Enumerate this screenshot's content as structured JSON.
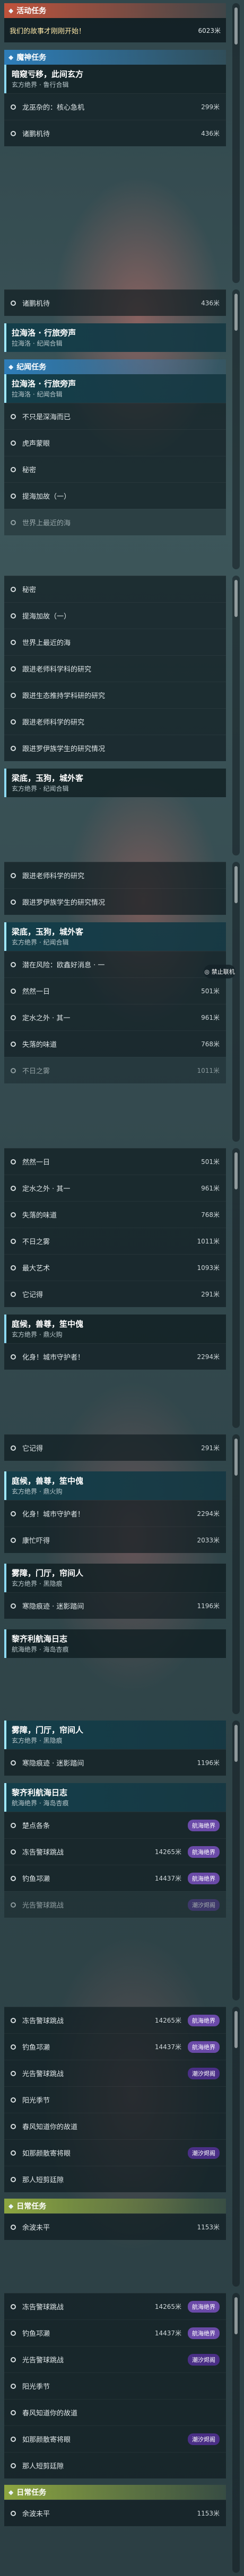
{
  "activity": {
    "category_label": "活动任务",
    "event_title": "我们的故事才刚刚开始！",
    "event_distance": "6023米"
  },
  "main_quest": {
    "category_label": "魔神任务",
    "header_title": "暗窥亏移，此间玄方",
    "header_subtitle": "玄方绝界 · 鲁行合辑",
    "items": [
      {
        "label": "龙巫杂的：核心急机",
        "distance": "299米"
      },
      {
        "label": "诸鹏机待",
        "distance": "436米"
      }
    ],
    "last_item": {
      "label": "诸鹏机待",
      "distance": "436米"
    }
  },
  "quest_groups": [
    {
      "title": "拉海洛 · 行旅旁声",
      "subtitle": "拉海洛 · 纪闻合辑"
    },
    {
      "title": "梁底，玉狗，城外客",
      "subtitle": "玄方绝界 · 纪闻合辑"
    },
    {
      "title": "梁底，玉狗，城外客",
      "subtitle": "玄方绝界 · 纪闻合辑"
    },
    {
      "title": "庭候，兽尊，笙中傀",
      "subtitle": "玄方绝界 · 鼎火购"
    },
    {
      "title": "庭候，兽尊，笙中傀",
      "subtitle": "玄方绝界 · 鼎火购"
    },
    {
      "title": "雾障，门厅，帘间人",
      "subtitle": "玄方绝界 · 黑隐痕"
    },
    {
      "title": "黎齐利航海日志",
      "subtitle": "航海绝界 · 海岛杏痕"
    },
    {
      "title": "雾障，门厅，帘间人",
      "subtitle": "玄方绝界 · 黑隐痕"
    },
    {
      "title": "黎齐利航海日志",
      "subtitle": "航海绝界 · 海岛杏痕"
    }
  ],
  "explore": {
    "category_label": "纪闻任务",
    "group_a": [
      {
        "label": "不只是深海而已",
        "distance": ""
      },
      {
        "label": "虎声蒙眼",
        "distance": ""
      },
      {
        "label": "秘密",
        "distance": ""
      },
      {
        "label": "提海加故（一）",
        "distance": ""
      },
      {
        "label": "世界上最近的海",
        "distance": ""
      }
    ],
    "group_b": [
      {
        "label": "秘密",
        "distance": ""
      },
      {
        "label": "提海加故（一）",
        "distance": ""
      },
      {
        "label": "世界上最近的海",
        "distance": ""
      },
      {
        "label": "跟进老师科学科的研究",
        "distance": ""
      },
      {
        "label": "跟进生态推持学科研的研究",
        "distance": ""
      },
      {
        "label": "跟进老师科学的研究",
        "distance": ""
      },
      {
        "label": "跟进罗伊族学生的研究情况",
        "distance": ""
      }
    ],
    "group_c": [
      {
        "label": "跟进老师科学的研究",
        "distance": ""
      },
      {
        "label": "跟进罗伊族学生的研究情况",
        "distance": ""
      }
    ],
    "group_d": [
      {
        "label": "潜在风险：欧鑫好消息 · 一",
        "distance": ""
      },
      {
        "label": "然然一日",
        "distance": "501米"
      },
      {
        "label": "定水之外 · 其一",
        "distance": "961米"
      },
      {
        "label": "失落的味道",
        "distance": "768米"
      },
      {
        "label": "不日之雾",
        "distance": "1011米"
      }
    ],
    "group_e": [
      {
        "label": "然然一日",
        "distance": "501米"
      },
      {
        "label": "定水之外 · 其一",
        "distance": "961米"
      },
      {
        "label": "失落的味道",
        "distance": "768米"
      },
      {
        "label": "不日之雾",
        "distance": "1011米"
      },
      {
        "label": "最大艺术",
        "distance": "1093米"
      },
      {
        "label": "它记得",
        "distance": "291米"
      }
    ],
    "group_f": [
      {
        "label": "化身！城市守护者！",
        "distance": "2294米"
      }
    ],
    "group_g": [
      {
        "label": "它记得",
        "distance": "291米"
      }
    ],
    "group_h": [
      {
        "label": "化身！城市守护者！",
        "distance": "2294米"
      },
      {
        "label": "康忙吓得",
        "distance": "2033米"
      }
    ],
    "group_i": [
      {
        "label": "寒隐痕迹 · 迷影踏间",
        "distance": "1196米"
      }
    ],
    "group_j": [
      {
        "label": "寒隐痕迹 · 迷影踏间",
        "distance": "1196米"
      }
    ],
    "group_k": [
      {
        "label": "楚点各条",
        "distance": "",
        "badge": "航海绝界"
      },
      {
        "label": "冻告警球跳战",
        "distance": "14265米",
        "badge": "航海绝界"
      },
      {
        "label": "钓鱼邛濑",
        "distance": "14437米",
        "badge": "航海绝界"
      },
      {
        "label": "光告警球跳战",
        "distance": "",
        "badge": "潮汐烬阁"
      }
    ],
    "group_l": [
      {
        "label": "冻告警球跳战",
        "distance": "14265米",
        "badge": "航海绝界"
      },
      {
        "label": "钓鱼邛濑",
        "distance": "14437米",
        "badge": "航海绝界"
      },
      {
        "label": "光告警球跳战",
        "distance": "",
        "badge": "潮汐烬阁"
      },
      {
        "label": "阳光季节",
        "distance": "",
        "badge": ""
      },
      {
        "label": "春风知道你的故道",
        "distance": "",
        "badge": ""
      },
      {
        "label": "如那颜散寄将眼",
        "distance": "",
        "badge": "潮汐烬阁"
      },
      {
        "label": "那人短剪廷隙",
        "distance": "",
        "badge": ""
      }
    ]
  },
  "daily": {
    "category_label": "日常任务",
    "item": {
      "label": "余波未平",
      "distance": "1153米"
    }
  },
  "float_button": {
    "label": "禁止联机"
  }
}
